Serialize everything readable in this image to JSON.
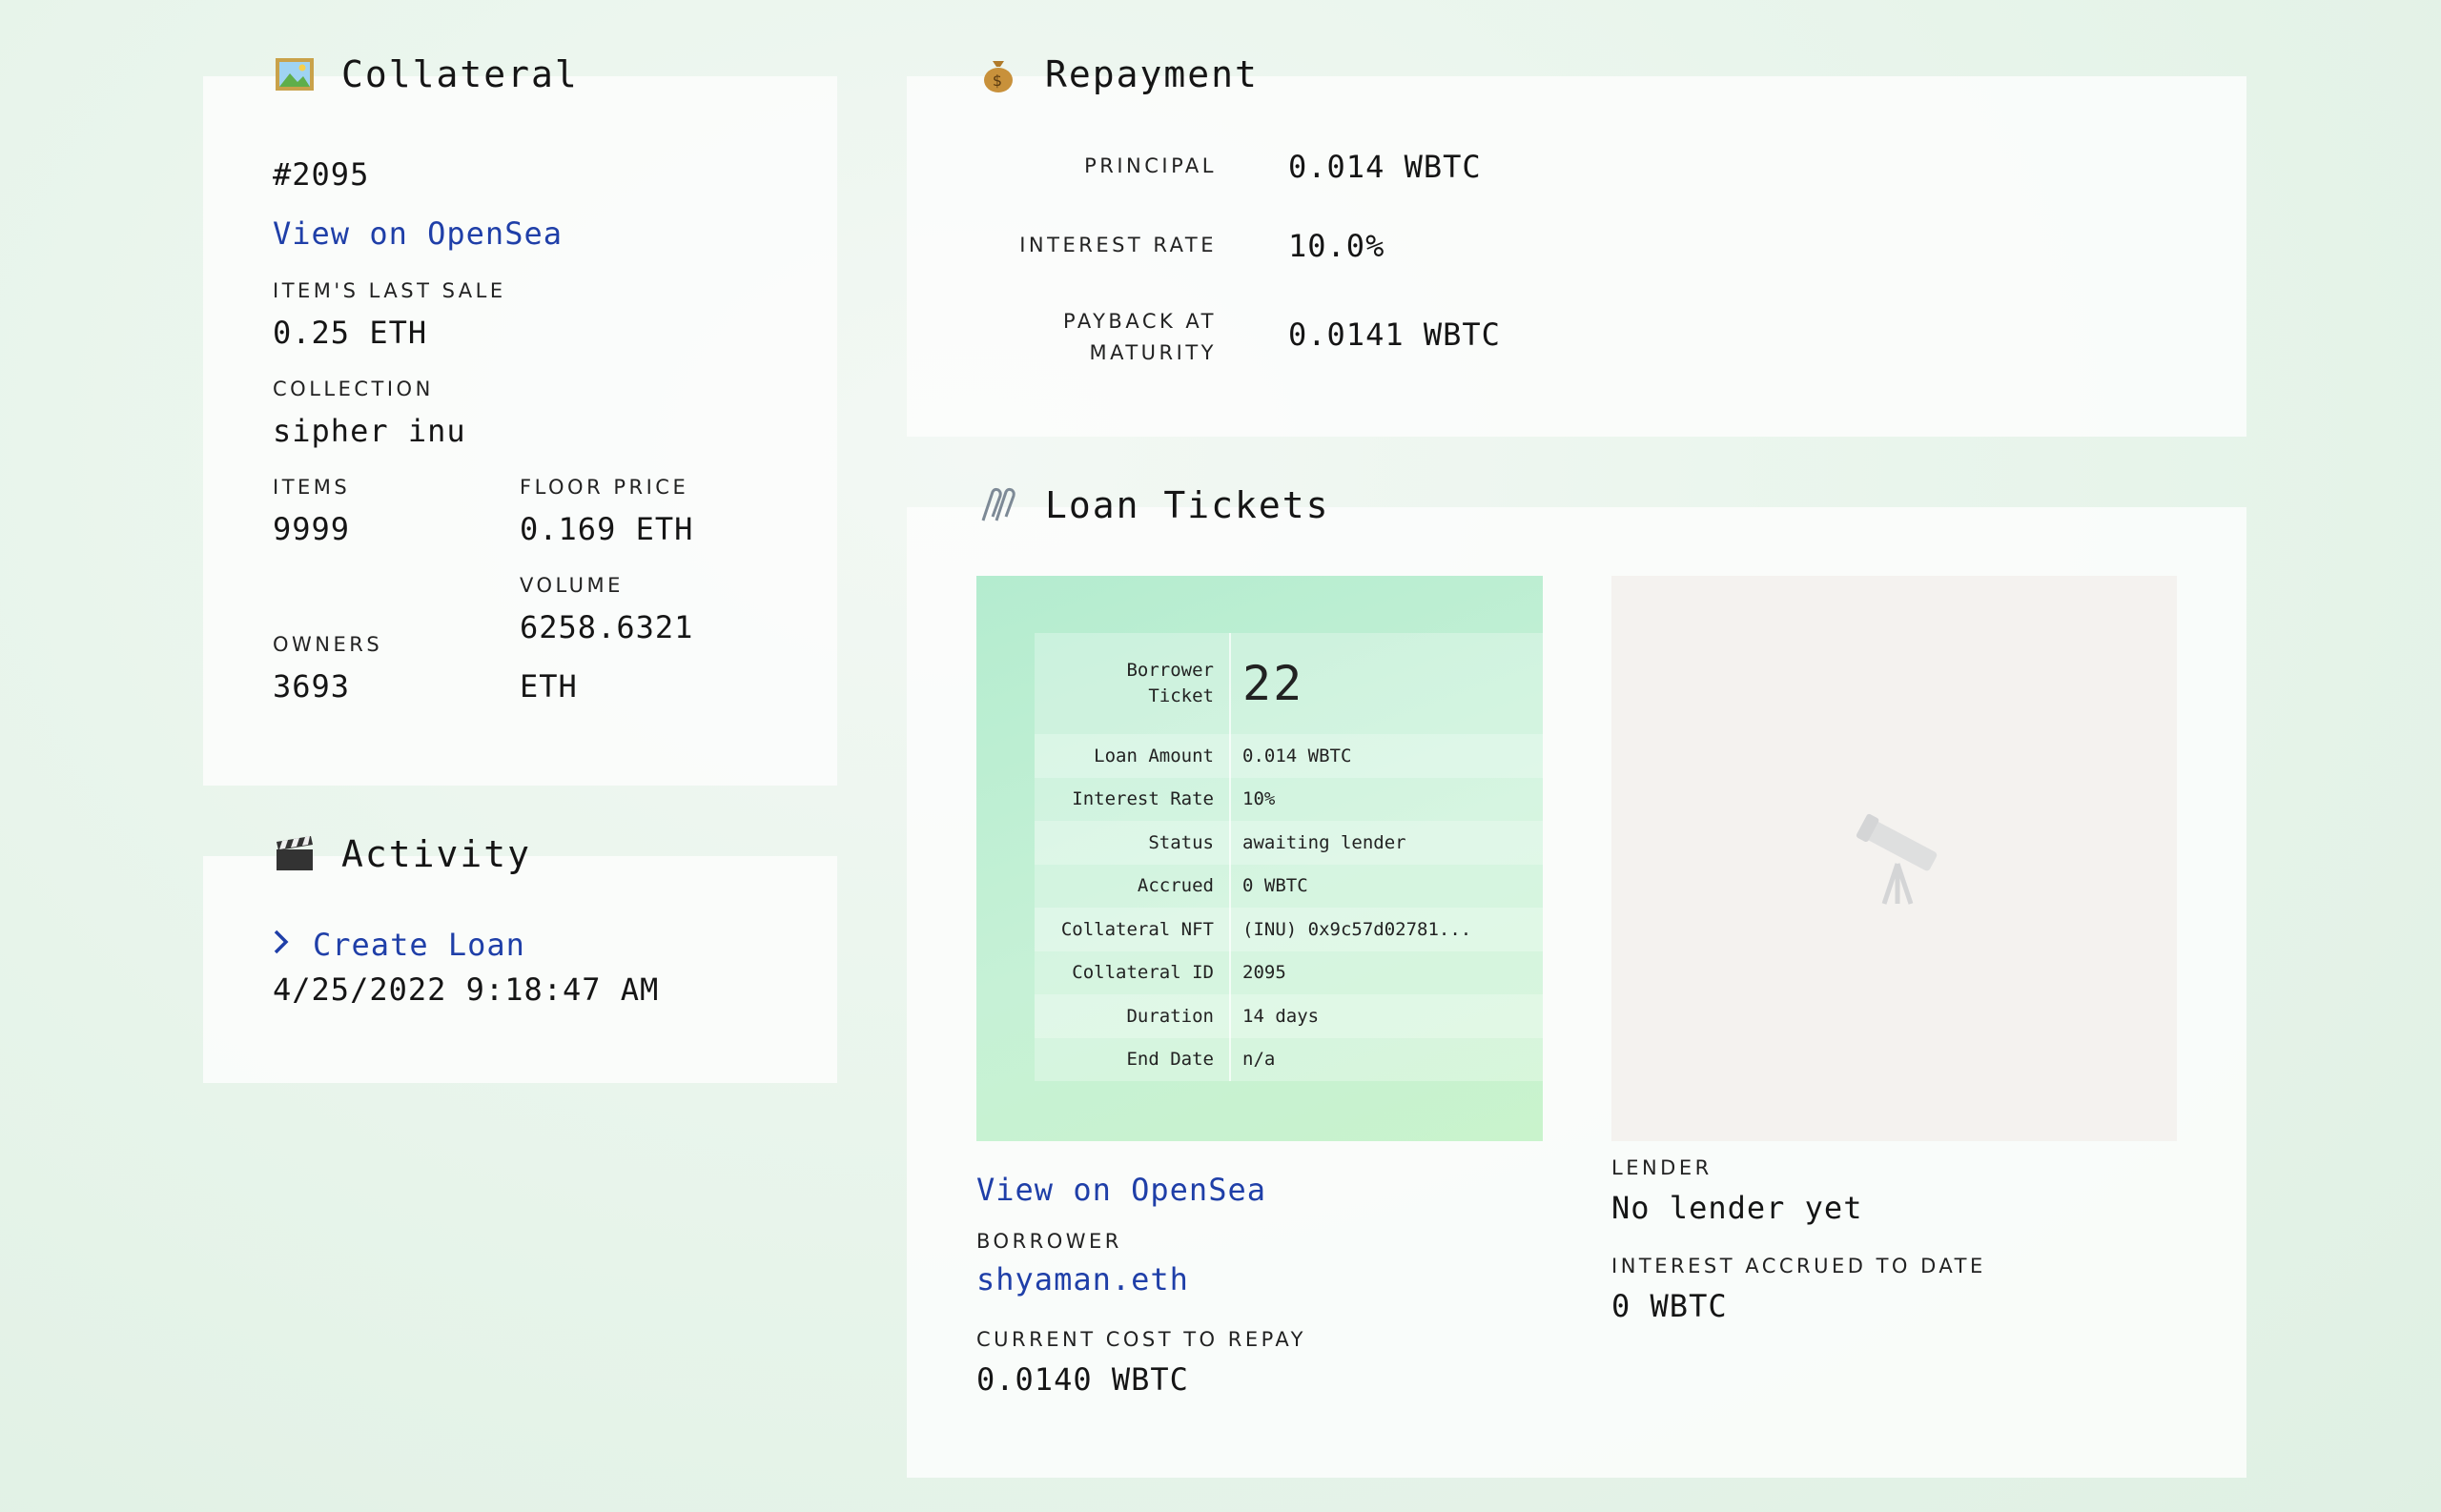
{
  "collateral": {
    "icon": "framed-picture-icon",
    "title": "Collateral",
    "token_id": "#2095",
    "opensea_link": "View on OpenSea",
    "last_sale_label": "ITEM'S LAST SALE",
    "last_sale_value": "0.25 ETH",
    "collection_label": "COLLECTION",
    "collection_value": "sipher inu",
    "items_label": "ITEMS",
    "items_value": "9999",
    "floor_label": "FLOOR PRICE",
    "floor_value": "0.169 ETH",
    "volume_label": "VOLUME",
    "volume_value_line1": "6258.6321",
    "volume_value_line2": "ETH",
    "owners_label": "OWNERS",
    "owners_value": "3693"
  },
  "activity": {
    "icon": "clapper-board-icon",
    "title": "Activity",
    "event_label": "Create Loan",
    "event_time": "4/25/2022 9:18:47 AM"
  },
  "repayment": {
    "icon": "money-bag-icon",
    "title": "Repayment",
    "rows": [
      {
        "label": "PRINCIPAL",
        "value": "0.014 WBTC"
      },
      {
        "label": "INTEREST RATE",
        "value": "10.0%"
      },
      {
        "label_line1": "PAYBACK AT",
        "label_line2": "MATURITY",
        "value": "0.0141 WBTC"
      }
    ]
  },
  "tickets": {
    "icon": "paperclips-icon",
    "title": "Loan Tickets",
    "borrower_ticket": {
      "header_label_line1": "Borrower",
      "header_label_line2": "Ticket",
      "number": "22",
      "rows": [
        {
          "k": "Loan Amount",
          "v": "0.014 WBTC"
        },
        {
          "k": "Interest Rate",
          "v": "10%"
        },
        {
          "k": "Status",
          "v": "awaiting lender"
        },
        {
          "k": "Accrued",
          "v": "0 WBTC"
        },
        {
          "k": "Collateral NFT",
          "v": "(INU) 0x9c57d02781..."
        },
        {
          "k": "Collateral ID",
          "v": "2095"
        },
        {
          "k": "Duration",
          "v": "14 days"
        },
        {
          "k": "End Date",
          "v": "n/a"
        }
      ]
    },
    "opensea_link": "View on OpenSea",
    "borrower_label": "BORROWER",
    "borrower_value": "shyaman.eth",
    "cost_label": "CURRENT COST TO REPAY",
    "cost_value": "0.0140 WBTC",
    "lender_placeholder_icon": "telescope-icon",
    "lender_label": "LENDER",
    "lender_value": "No lender yet",
    "accrued_label": "INTEREST ACCRUED TO DATE",
    "accrued_value": "0 WBTC"
  }
}
